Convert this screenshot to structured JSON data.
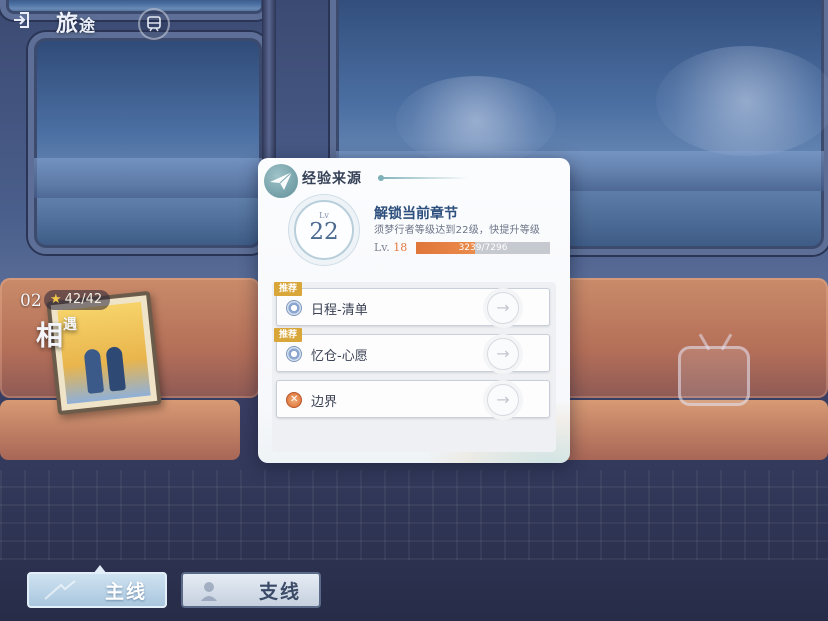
{
  "hud": {
    "title_main": "旅",
    "title_sub": "途"
  },
  "stage": {
    "number": "02",
    "stars": "42/42",
    "name_main": "相",
    "name_sub": "遇"
  },
  "tabs": {
    "main_label": "主线",
    "side_label": "支线"
  },
  "panel": {
    "title": "经验来源",
    "level_prefix": "Lv",
    "required_level": "22",
    "unlock_title": "解锁当前章节",
    "unlock_desc": "须梦行者等级达到22级，快提升等级",
    "current_level_prefix": "Lv.",
    "current_level": "18",
    "exp_text": "3239/7296",
    "exp_current": 3239,
    "exp_max": 7296,
    "sources": [
      {
        "label": "日程-清单",
        "tag": "推荐",
        "icon": "schedule-icon"
      },
      {
        "label": "忆仓-心愿",
        "tag": "推荐",
        "icon": "wish-icon"
      },
      {
        "label": "边界",
        "tag": "",
        "icon": "boundary-icon"
      }
    ]
  },
  "colors": {
    "accent_orange": "#e0763a",
    "tag_gold": "#d9a63a",
    "title_blue": "#2c4f7d"
  }
}
